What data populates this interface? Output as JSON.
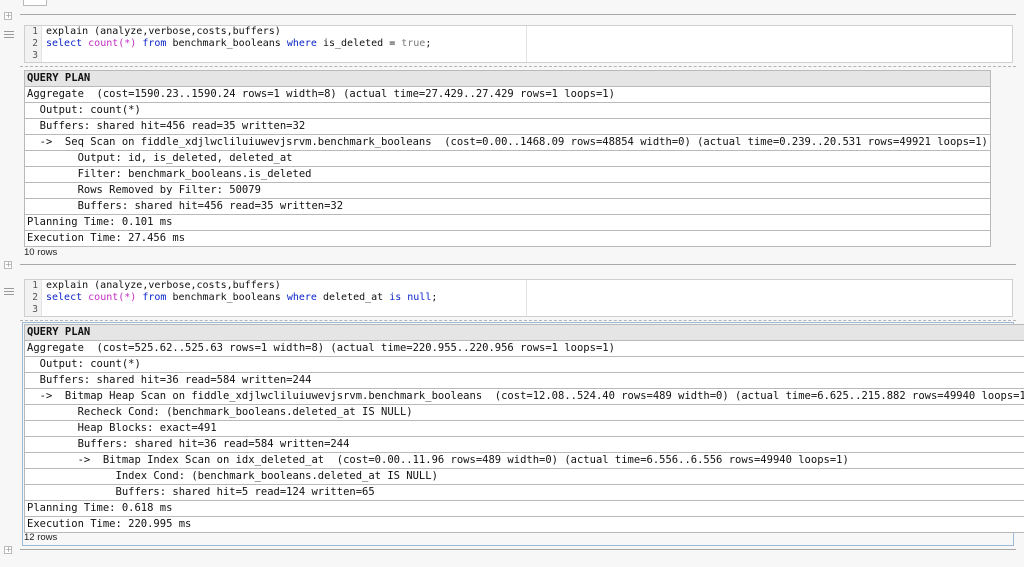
{
  "queries": [
    {
      "lines": [
        {
          "num": "1",
          "tokens": [
            {
              "t": "explain (analyze,verbose,costs,buffers)",
              "c": ""
            }
          ]
        },
        {
          "num": "2",
          "tokens": [
            {
              "t": "select ",
              "c": "kw"
            },
            {
              "t": "count(*)",
              "c": "fn"
            },
            {
              "t": " from ",
              "c": "kw"
            },
            {
              "t": "benchmark_booleans ",
              "c": ""
            },
            {
              "t": "where",
              "c": "kw"
            },
            {
              "t": " is_deleted = ",
              "c": ""
            },
            {
              "t": "true",
              "c": "lit"
            },
            {
              "t": ";",
              "c": ""
            }
          ]
        },
        {
          "num": "3",
          "tokens": []
        }
      ],
      "plan_header": "QUERY PLAN",
      "plan_rows": [
        "Aggregate  (cost=1590.23..1590.24 rows=1 width=8) (actual time=27.429..27.429 rows=1 loops=1)",
        "  Output: count(*)",
        "  Buffers: shared hit=456 read=35 written=32",
        "  ->  Seq Scan on fiddle_xdjlwcliluiuwevjsrvm.benchmark_booleans  (cost=0.00..1468.09 rows=48854 width=0) (actual time=0.239..20.531 rows=49921 loops=1)",
        "        Output: id, is_deleted, deleted_at",
        "        Filter: benchmark_booleans.is_deleted",
        "        Rows Removed by Filter: 50079",
        "        Buffers: shared hit=456 read=35 written=32",
        "Planning Time: 0.101 ms",
        "Execution Time: 27.456 ms"
      ],
      "row_count": "10 rows"
    },
    {
      "lines": [
        {
          "num": "1",
          "tokens": [
            {
              "t": "explain (analyze,verbose,costs,buffers)",
              "c": ""
            }
          ]
        },
        {
          "num": "2",
          "tokens": [
            {
              "t": "select ",
              "c": "kw"
            },
            {
              "t": "count(*)",
              "c": "fn"
            },
            {
              "t": " from ",
              "c": "kw"
            },
            {
              "t": "benchmark_booleans ",
              "c": ""
            },
            {
              "t": "where",
              "c": "kw"
            },
            {
              "t": " deleted_at ",
              "c": ""
            },
            {
              "t": "is",
              "c": "kw"
            },
            {
              "t": " ",
              "c": ""
            },
            {
              "t": "null",
              "c": "kw"
            },
            {
              "t": ";",
              "c": ""
            }
          ]
        },
        {
          "num": "3",
          "tokens": []
        }
      ],
      "plan_header": "QUERY PLAN",
      "plan_rows": [
        "Aggregate  (cost=525.62..525.63 rows=1 width=8) (actual time=220.955..220.956 rows=1 loops=1)",
        "  Output: count(*)",
        "  Buffers: shared hit=36 read=584 written=244",
        "  ->  Bitmap Heap Scan on fiddle_xdjlwcliluiuwevjsrvm.benchmark_booleans  (cost=12.08..524.40 rows=489 width=0) (actual time=6.625..215.882 rows=49940 loops=1)",
        "        Recheck Cond: (benchmark_booleans.deleted_at IS NULL)",
        "        Heap Blocks: exact=491",
        "        Buffers: shared hit=36 read=584 written=244",
        "        ->  Bitmap Index Scan on idx_deleted_at  (cost=0.00..11.96 rows=489 width=0) (actual time=6.556..6.556 rows=49940 loops=1)",
        "              Index Cond: (benchmark_booleans.deleted_at IS NULL)",
        "              Buffers: shared hit=5 read=124 written=65",
        "Planning Time: 0.618 ms",
        "Execution Time: 220.995 ms"
      ],
      "row_count": "12 rows"
    }
  ]
}
